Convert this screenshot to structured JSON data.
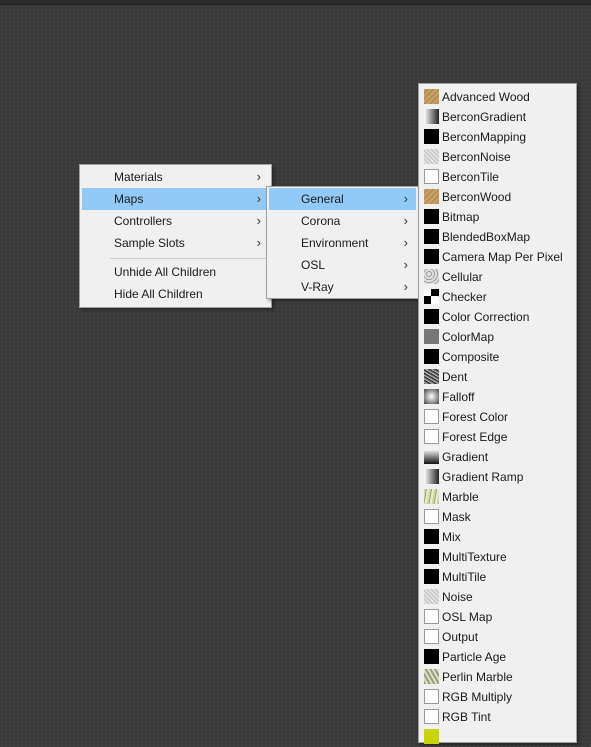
{
  "context_menu": {
    "items": [
      {
        "label": "Materials",
        "submenu": true
      },
      {
        "label": "Maps",
        "submenu": true,
        "highlighted": true
      },
      {
        "label": "Controllers",
        "submenu": true
      },
      {
        "label": "Sample Slots",
        "submenu": true
      },
      {
        "label": "Unhide All Children",
        "submenu": false
      },
      {
        "label": "Hide All Children",
        "submenu": false
      }
    ]
  },
  "maps_menu": {
    "items": [
      {
        "label": "General",
        "highlighted": true
      },
      {
        "label": "Corona"
      },
      {
        "label": "Environment"
      },
      {
        "label": "OSL"
      },
      {
        "label": "V-Ray"
      }
    ]
  },
  "general_maps": [
    {
      "label": "Advanced Wood",
      "icon": "wood"
    },
    {
      "label": "BerconGradient",
      "icon": "gradh"
    },
    {
      "label": "BerconMapping",
      "icon": "black"
    },
    {
      "label": "BerconNoise",
      "icon": "noise"
    },
    {
      "label": "BerconTile",
      "icon": "white"
    },
    {
      "label": "BerconWood",
      "icon": "wood"
    },
    {
      "label": "Bitmap",
      "icon": "black"
    },
    {
      "label": "BlendedBoxMap",
      "icon": "black"
    },
    {
      "label": "Camera Map Per Pixel",
      "icon": "black"
    },
    {
      "label": "Cellular",
      "icon": "cell"
    },
    {
      "label": "Checker",
      "icon": "checker"
    },
    {
      "label": "Color Correction",
      "icon": "black"
    },
    {
      "label": "ColorMap",
      "icon": "grey"
    },
    {
      "label": "Composite",
      "icon": "black"
    },
    {
      "label": "Dent",
      "icon": "dent"
    },
    {
      "label": "Falloff",
      "icon": "falloff"
    },
    {
      "label": "Forest Color",
      "icon": "white"
    },
    {
      "label": "Forest Edge",
      "icon": "white"
    },
    {
      "label": "Gradient",
      "icon": "gradv"
    },
    {
      "label": "Gradient Ramp",
      "icon": "gradh"
    },
    {
      "label": "Marble",
      "icon": "marble"
    },
    {
      "label": "Mask",
      "icon": "white"
    },
    {
      "label": "Mix",
      "icon": "black"
    },
    {
      "label": "MultiTexture",
      "icon": "black"
    },
    {
      "label": "MultiTile",
      "icon": "black"
    },
    {
      "label": "Noise",
      "icon": "noise"
    },
    {
      "label": "OSL Map",
      "icon": "white"
    },
    {
      "label": "Output",
      "icon": "white"
    },
    {
      "label": "Particle Age",
      "icon": "black"
    },
    {
      "label": "Perlin Marble",
      "icon": "perlin"
    },
    {
      "label": "RGB Multiply",
      "icon": "white"
    },
    {
      "label": "RGB Tint",
      "icon": "white"
    },
    {
      "label": "",
      "icon": "yellow"
    }
  ],
  "arrow_glyph": "›"
}
